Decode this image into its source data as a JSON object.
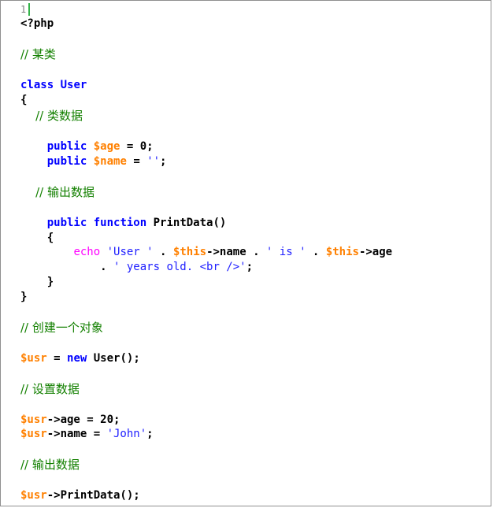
{
  "editor": {
    "line_number": "1",
    "lines": [
      "<?php",
      "// 某类",
      "class User",
      "{",
      "    // 类数据",
      "    public $age = 0;",
      "    public $name = '';",
      "    // 输出数据",
      "    public function PrintData()",
      "    {",
      "        echo 'User ' . $this->name . ' is ' . $this->age",
      "            . ' years old. <br />';",
      "    }",
      "}",
      "// 创建一个对象",
      "$usr = new User();",
      "// 设置数据",
      "$usr->age = 20;",
      "$usr->name = 'John';",
      "// 输出数据",
      "$usr->PrintData();"
    ]
  },
  "colors": {
    "comment": "#138000",
    "keyword": "#0000ff",
    "variable": "#ff8000",
    "echo": "#ff00ff",
    "string": "#2020ff",
    "cursor": "#34b34a"
  }
}
